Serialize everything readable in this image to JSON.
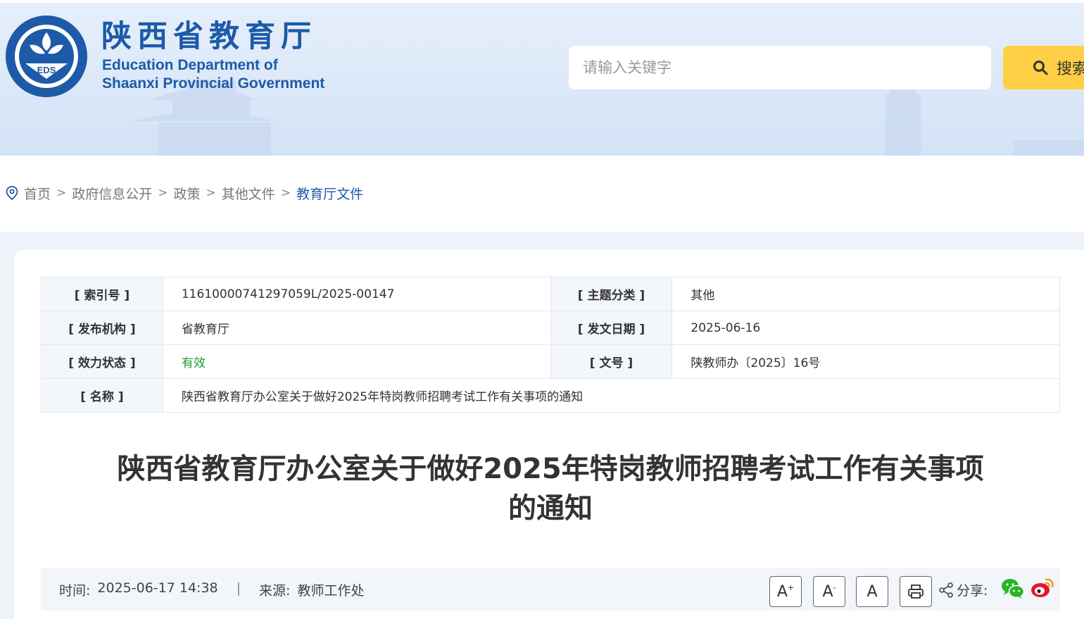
{
  "header": {
    "logo_text": "EDS",
    "title_cn": "陕西省教育厅",
    "title_en_line1": "Education Department of",
    "title_en_line2": "Shaanxi Provincial Government",
    "search_placeholder": "请输入关键字",
    "search_button": "搜索"
  },
  "breadcrumb": {
    "items": [
      "首页",
      "政府信息公开",
      "政策",
      "其他文件",
      "教育厅文件"
    ],
    "separator": ">"
  },
  "meta": {
    "index_label": "[ 索引号 ]",
    "index_value": "11610000741297059L/2025-00147",
    "topic_label": "[ 主题分类 ]",
    "topic_value": "其他",
    "publisher_label": "[ 发布机构 ]",
    "publisher_value": "省教育厅",
    "date_label": "[ 发文日期 ]",
    "date_value": "2025-06-16",
    "status_label": "[ 效力状态 ]",
    "status_value": "有效",
    "docno_label": "[ 文号 ]",
    "docno_value": "陕教师办〔2025〕16号",
    "name_label": "[ 名称 ]",
    "name_value": "陕西省教育厅办公室关于做好2025年特岗教师招聘考试工作有关事项的通知"
  },
  "article": {
    "title_line1": "陕西省教育厅办公室关于做好2025年特岗教师招聘考试工作有关事项",
    "title_line2": "的通知",
    "time_label": "时间:",
    "time_value": "2025-06-17 14:38",
    "divider": "|",
    "source_label": "来源:",
    "source_value": "教师工作处"
  },
  "toolbar": {
    "font_larger": "A",
    "font_smaller": "A",
    "font_default": "A",
    "plus": "+",
    "minus": "-",
    "share_label": "分享:"
  },
  "colors": {
    "brand_blue": "#1d5aa8",
    "search_button": "#ffd046",
    "valid_green": "#1f9a2a",
    "wechat_green": "#2ab32a",
    "weibo_red": "#e6162d"
  }
}
